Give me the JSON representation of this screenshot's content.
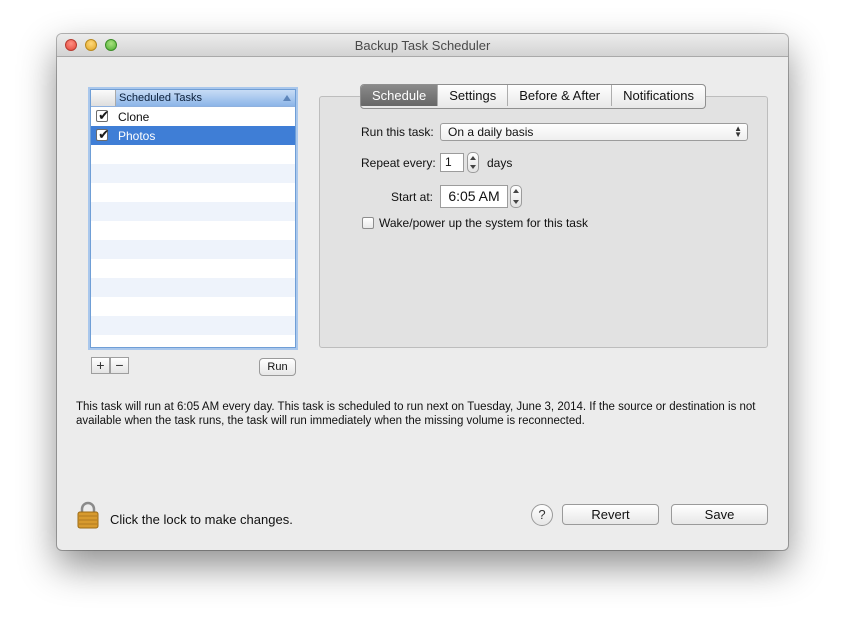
{
  "window": {
    "title": "Backup Task Scheduler"
  },
  "task_list": {
    "header": "Scheduled Tasks",
    "items": [
      {
        "label": "Clone",
        "checked": true,
        "selected": false
      },
      {
        "label": "Photos",
        "checked": true,
        "selected": true
      }
    ]
  },
  "list_controls": {
    "add_label": "+",
    "remove_label": "−",
    "run_label": "Run"
  },
  "tabs": [
    {
      "label": "Schedule",
      "active": true
    },
    {
      "label": "Settings",
      "active": false
    },
    {
      "label": "Before & After",
      "active": false
    },
    {
      "label": "Notifications",
      "active": false
    }
  ],
  "schedule": {
    "run_label": "Run this task:",
    "run_value": "On a daily basis",
    "repeat_label": "Repeat every:",
    "repeat_value": "1",
    "repeat_unit": "days",
    "start_label": "Start at:",
    "start_value": "6:05 AM",
    "wake_label": "Wake/power up the system for this task",
    "wake_checked": false
  },
  "description": "This task will run at 6:05 AM every day. This task is scheduled to run next on Tuesday, June 3, 2014. If the source or destination is not available when the task runs, the task will run immediately when the missing volume is reconnected.",
  "footer": {
    "lock_text": "Click the lock to make changes.",
    "help_label": "?",
    "revert_label": "Revert",
    "save_label": "Save"
  },
  "colors": {
    "selection": "#3f7ed6",
    "list_header": "#8cb5e8",
    "active_tab": "#6f6f6f"
  }
}
